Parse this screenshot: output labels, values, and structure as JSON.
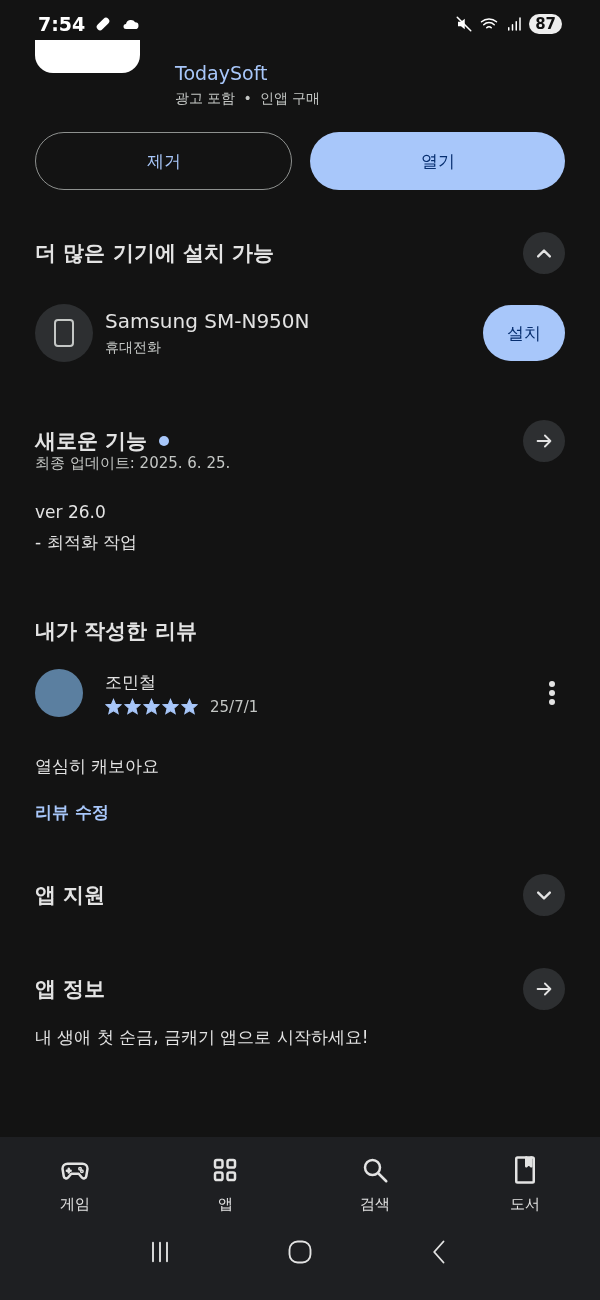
{
  "status_bar": {
    "time": "7:54",
    "battery": "87"
  },
  "app": {
    "developer": "TodaySoft",
    "meta": [
      "광고 포함",
      "인앱 구매"
    ],
    "meta_separator": "•"
  },
  "actions": [
    {
      "label": "제거",
      "kind": "outline"
    },
    {
      "label": "열기",
      "kind": "filled"
    }
  ],
  "devices_section": {
    "title": "더 많은 기기에 설치 가능",
    "expanded": true,
    "devices": [
      {
        "name": "Samsung SM-N950N",
        "type": "휴대전화",
        "button": "설치"
      }
    ]
  },
  "whats_new": {
    "title": "새로운 기능",
    "unread": true,
    "updated": "최종 업데이트: 2025. 6. 25.",
    "lines": [
      "ver 26.0",
      "- 최적화 작업"
    ]
  },
  "my_review": {
    "title": "내가 작성한 리뷰",
    "author": "조민철",
    "stars": 5,
    "date": "25/7/1",
    "text": "열심히 캐보아요",
    "edit_link": "리뷰 수정"
  },
  "sections": [
    {
      "title": "앱 지원",
      "kind": "expand",
      "expanded": false
    },
    {
      "title": "앱 정보",
      "kind": "arrow",
      "description": "내 생애 첫 순금, 금캐기 앱으로 시작하세요!"
    }
  ],
  "bottom_nav": [
    {
      "label": "게임"
    },
    {
      "label": "앱"
    },
    {
      "label": "검색"
    },
    {
      "label": "도서"
    }
  ]
}
